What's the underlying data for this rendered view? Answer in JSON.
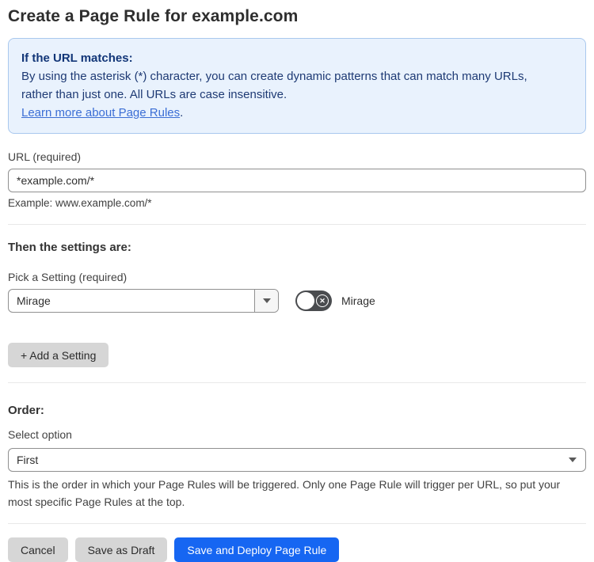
{
  "page": {
    "title": "Create a Page Rule for example.com"
  },
  "info_box": {
    "heading": "If the URL matches:",
    "body": "By using the asterisk (*) character, you can create dynamic patterns that can match many URLs, rather than just one. All URLs are case insensitive.",
    "link_label": "Learn more about Page Rules",
    "link_suffix": "."
  },
  "url_field": {
    "label": "URL (required)",
    "value": "*example.com/*",
    "example": "Example: www.example.com/*"
  },
  "settings_section": {
    "heading": "Then the settings are:",
    "picker_label": "Pick a Setting (required)",
    "selected_setting": "Mirage",
    "toggle_label": "Mirage",
    "toggle_state": "off",
    "toggle_glyph": "✕",
    "add_setting_button": "+ Add a Setting"
  },
  "order_section": {
    "heading": "Order:",
    "label": "Select option",
    "selected_option": "First",
    "help": "This is the order in which your Page Rules will be triggered. Only one Page Rule will trigger per URL, so put your most specific Page Rules at the top."
  },
  "actions": {
    "cancel": "Cancel",
    "save_as_draft": "Save as Draft",
    "save_and_deploy": "Save and Deploy Page Rule"
  },
  "colors": {
    "primary_button": "#1666f2",
    "info_background": "#e9f2fd",
    "info_border": "#a9c8ee",
    "info_text": "#1e3a74",
    "link": "#3b6ed5",
    "toggle_off": "#4a4c4f",
    "gray_button": "#d6d6d6"
  }
}
